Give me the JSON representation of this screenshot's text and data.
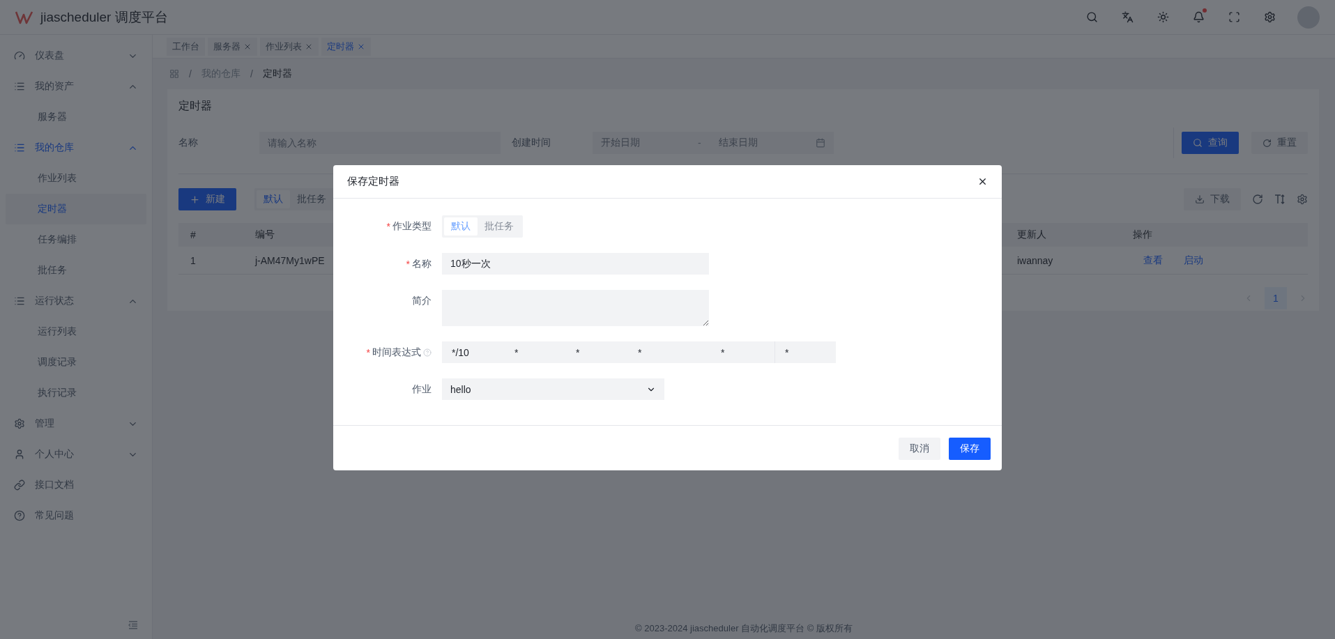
{
  "header": {
    "title": "jiascheduler 调度平台",
    "notification_dot": true
  },
  "sidebar": {
    "items": [
      {
        "label": "仪表盘",
        "expanded": false,
        "selected": false
      },
      {
        "label": "我的资产",
        "expanded": true,
        "children": [
          {
            "label": "服务器",
            "selected": false
          }
        ]
      },
      {
        "label": "我的仓库",
        "expanded": true,
        "children": [
          {
            "label": "作业列表",
            "selected": false
          },
          {
            "label": "定时器",
            "selected": true
          },
          {
            "label": "任务编排",
            "selected": false
          },
          {
            "label": "批任务",
            "selected": false
          }
        ]
      },
      {
        "label": "运行状态",
        "expanded": true,
        "children": [
          {
            "label": "运行列表",
            "selected": false
          },
          {
            "label": "调度记录",
            "selected": false
          },
          {
            "label": "执行记录",
            "selected": false
          }
        ]
      },
      {
        "label": "管理",
        "expanded": false,
        "selected": false
      },
      {
        "label": "个人中心",
        "expanded": false,
        "selected": false
      },
      {
        "label": "接口文档",
        "selected": false
      },
      {
        "label": "常见问题",
        "selected": false
      }
    ]
  },
  "tabs": [
    {
      "label": "工作台",
      "closable": false,
      "selected": false
    },
    {
      "label": "服务器",
      "closable": true,
      "selected": false
    },
    {
      "label": "作业列表",
      "closable": true,
      "selected": false
    },
    {
      "label": "定时器",
      "closable": true,
      "selected": true
    }
  ],
  "breadcrumb": {
    "separator": "/",
    "items": [
      "我的仓库",
      "定时器"
    ]
  },
  "card": {
    "title": "定时器",
    "filters": [
      {
        "label": "名称",
        "kind": "input",
        "placeholder": "请输入名称"
      },
      {
        "label": "创建时间",
        "kind": "daterange",
        "start_placeholder": "开始日期",
        "separator": "-",
        "end_placeholder": "结束日期"
      }
    ],
    "search_button": "查询",
    "reset_button": "重置",
    "new_button": "新建",
    "type_switch": [
      {
        "label": "默认",
        "selected": true
      },
      {
        "label": "批任务",
        "selected": false
      }
    ],
    "download_button": "下载",
    "table": {
      "columns": [
        "#",
        "编号",
        "更新人",
        "操作"
      ],
      "rows": [
        {
          "cells": [
            "1",
            "j-AM47My1wPE",
            "iwannay"
          ],
          "actions": [
            "查看",
            "启动"
          ]
        }
      ]
    },
    "pagination": {
      "pages": [
        {
          "label": "1",
          "selected": true
        }
      ]
    }
  },
  "modal": {
    "title": "保存定时器",
    "fields": [
      {
        "kind": "segmented",
        "label": "作业类型",
        "required": true,
        "disabled": true,
        "options": [
          {
            "label": "默认",
            "selected": true
          },
          {
            "label": "批任务",
            "selected": false
          }
        ]
      },
      {
        "kind": "input",
        "label": "名称",
        "required": true,
        "value": "10秒一次"
      },
      {
        "kind": "textarea",
        "label": "简介",
        "required": false
      },
      {
        "kind": "cron",
        "label": "时间表达式",
        "required": true,
        "help": true,
        "values": [
          "*/10",
          "*",
          "*",
          "*",
          "*",
          "*"
        ]
      },
      {
        "kind": "select",
        "label": "作业",
        "required": false,
        "value": "hello"
      }
    ],
    "buttons": [
      {
        "label": "取消",
        "kind": "secondary"
      },
      {
        "label": "保存",
        "kind": "primary"
      }
    ]
  },
  "footer": "© 2023-2024 jiascheduler 自动化调度平台 © 版权所有"
}
